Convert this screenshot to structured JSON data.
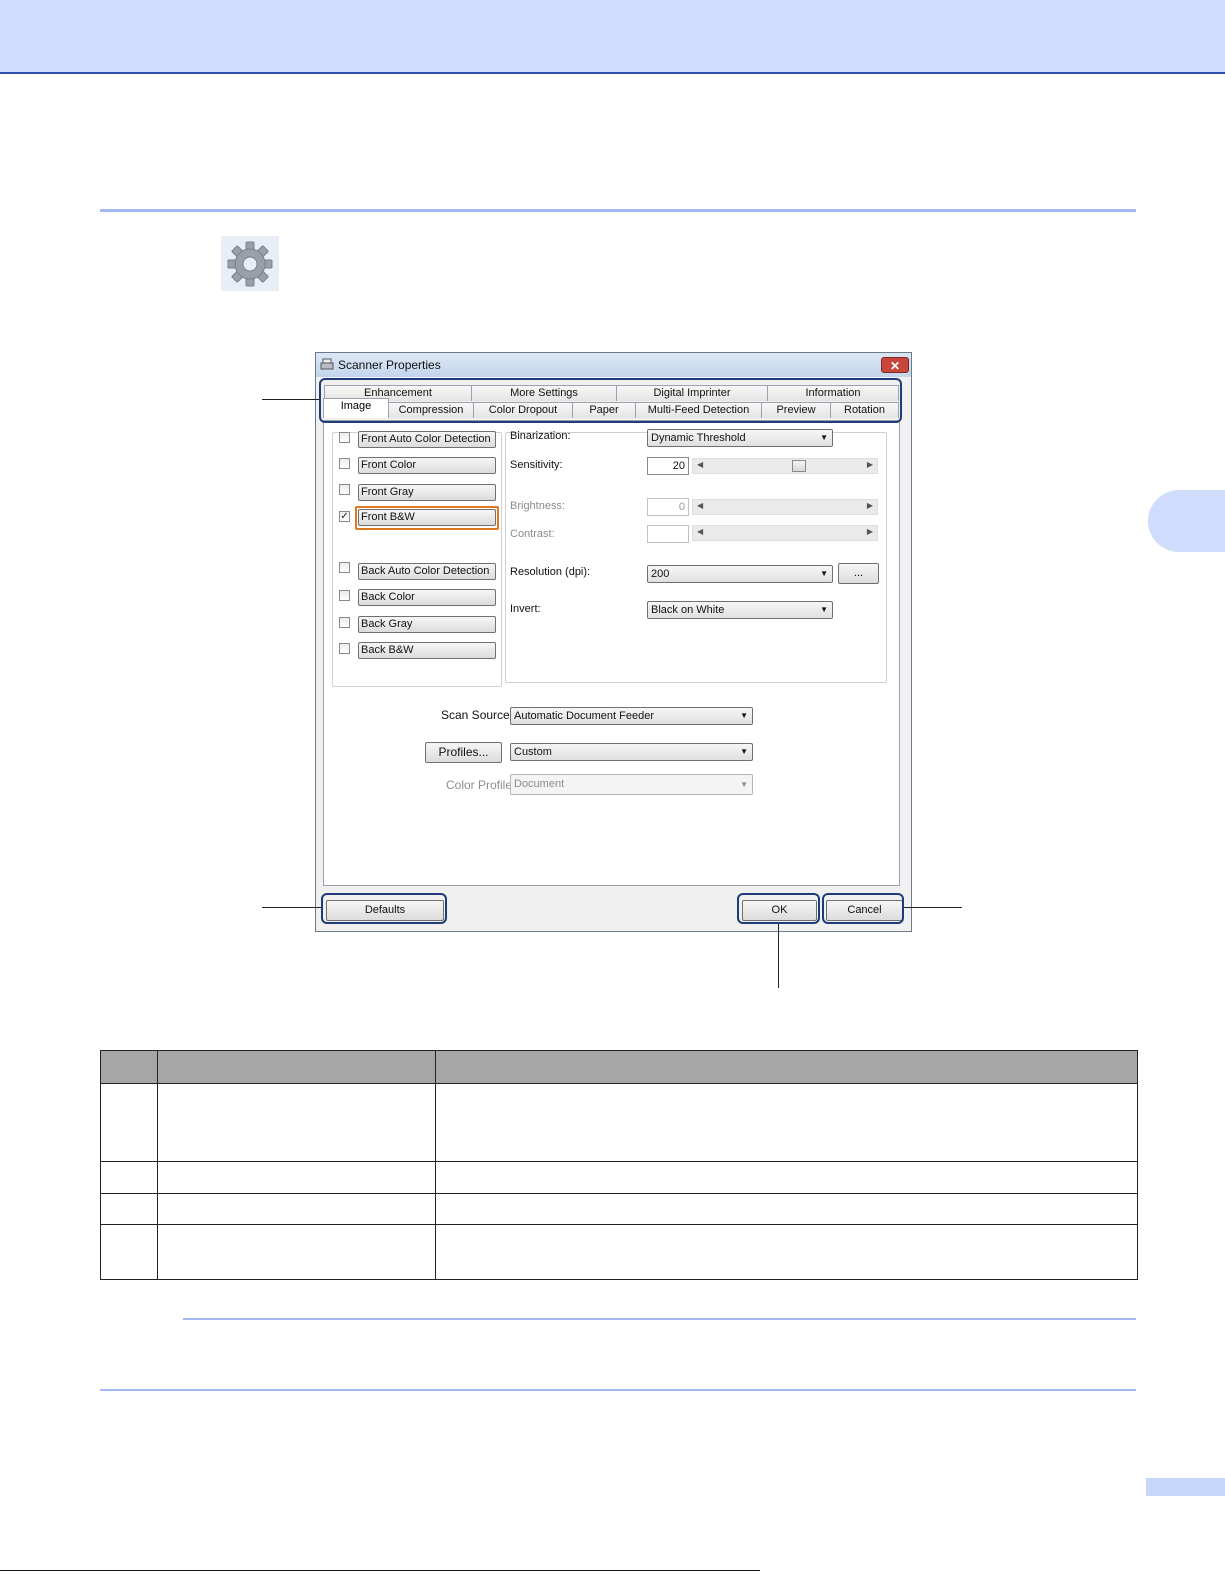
{
  "dialog": {
    "title": "Scanner Properties",
    "close_label": "✕",
    "tabs_back": [
      "Enhancement",
      "More Settings",
      "Digital Imprinter",
      "Information"
    ],
    "tabs_front": [
      "Image",
      "Compression",
      "Color Dropout",
      "Paper",
      "Multi-Feed Detection",
      "Preview",
      "Rotation"
    ],
    "active_tab": "Image",
    "image_types": [
      {
        "label": "Front Auto Color Detection",
        "checked": false
      },
      {
        "label": "Front Color",
        "checked": false
      },
      {
        "label": "Front Gray",
        "checked": false
      },
      {
        "label": "Front B&W",
        "checked": true
      },
      {
        "label": "Back Auto Color Detection",
        "checked": false
      },
      {
        "label": "Back Color",
        "checked": false
      },
      {
        "label": "Back Gray",
        "checked": false
      },
      {
        "label": "Back B&W",
        "checked": false
      }
    ],
    "settings": {
      "binarization_label": "Binarization:",
      "binarization_value": "Dynamic Threshold",
      "sensitivity_label": "Sensitivity:",
      "sensitivity_value": "20",
      "sensitivity_level": 0.6,
      "brightness_label": "Brightness:",
      "brightness_value": "0",
      "contrast_label": "Contrast:",
      "contrast_value": "",
      "resolution_label": "Resolution (dpi):",
      "resolution_value": "200",
      "more_button": "...",
      "invert_label": "Invert:",
      "invert_value": "Black on White"
    },
    "scan_source_label": "Scan Source:",
    "scan_source_value": "Automatic Document Feeder",
    "profiles_button": "Profiles...",
    "profile_value": "Custom",
    "color_profile_label": "Color Profile:",
    "color_profile_value": "Document",
    "defaults_button": "Defaults",
    "ok_button": "OK",
    "cancel_button": "Cancel"
  },
  "colors": {
    "header_band": "#cfdcfb",
    "rule": "#a3b8f2",
    "callout": "#1f3b7a",
    "focus": "#e0781e"
  }
}
